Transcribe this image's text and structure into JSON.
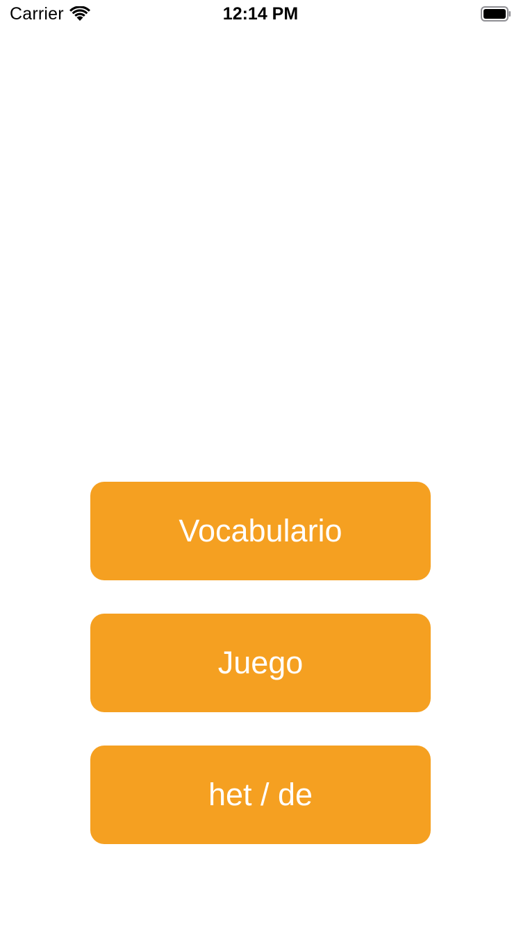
{
  "status_bar": {
    "carrier": "Carrier",
    "time": "12:14 PM",
    "wifi_icon": "wifi-icon",
    "battery_icon": "battery-icon"
  },
  "menu": {
    "accent_color": "#f5a021",
    "items": [
      {
        "label": "Vocabulario"
      },
      {
        "label": "Juego"
      },
      {
        "label": "het / de"
      }
    ]
  }
}
